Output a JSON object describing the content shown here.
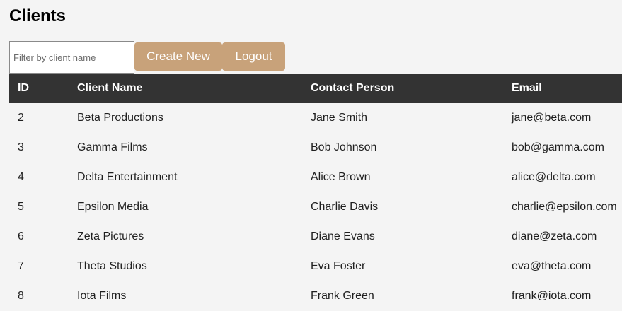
{
  "page": {
    "title": "Clients"
  },
  "toolbar": {
    "filter_placeholder": "Filter by client name",
    "create_label": "Create New",
    "logout_label": "Logout"
  },
  "colors": {
    "button_bg": "#c8a27a",
    "header_bg": "#333333",
    "page_bg": "#f4f4f4"
  },
  "table": {
    "columns": [
      "ID",
      "Client Name",
      "Contact Person",
      "Email"
    ],
    "rows": [
      {
        "id": "2",
        "name": "Beta Productions",
        "contact": "Jane Smith",
        "email": "jane@beta.com"
      },
      {
        "id": "3",
        "name": "Gamma Films",
        "contact": "Bob Johnson",
        "email": "bob@gamma.com"
      },
      {
        "id": "4",
        "name": "Delta Entertainment",
        "contact": "Alice Brown",
        "email": "alice@delta.com"
      },
      {
        "id": "5",
        "name": "Epsilon Media",
        "contact": "Charlie Davis",
        "email": "charlie@epsilon.com"
      },
      {
        "id": "6",
        "name": "Zeta Pictures",
        "contact": "Diane Evans",
        "email": "diane@zeta.com"
      },
      {
        "id": "7",
        "name": "Theta Studios",
        "contact": "Eva Foster",
        "email": "eva@theta.com"
      },
      {
        "id": "8",
        "name": "Iota Films",
        "contact": "Frank Green",
        "email": "frank@iota.com"
      }
    ]
  }
}
